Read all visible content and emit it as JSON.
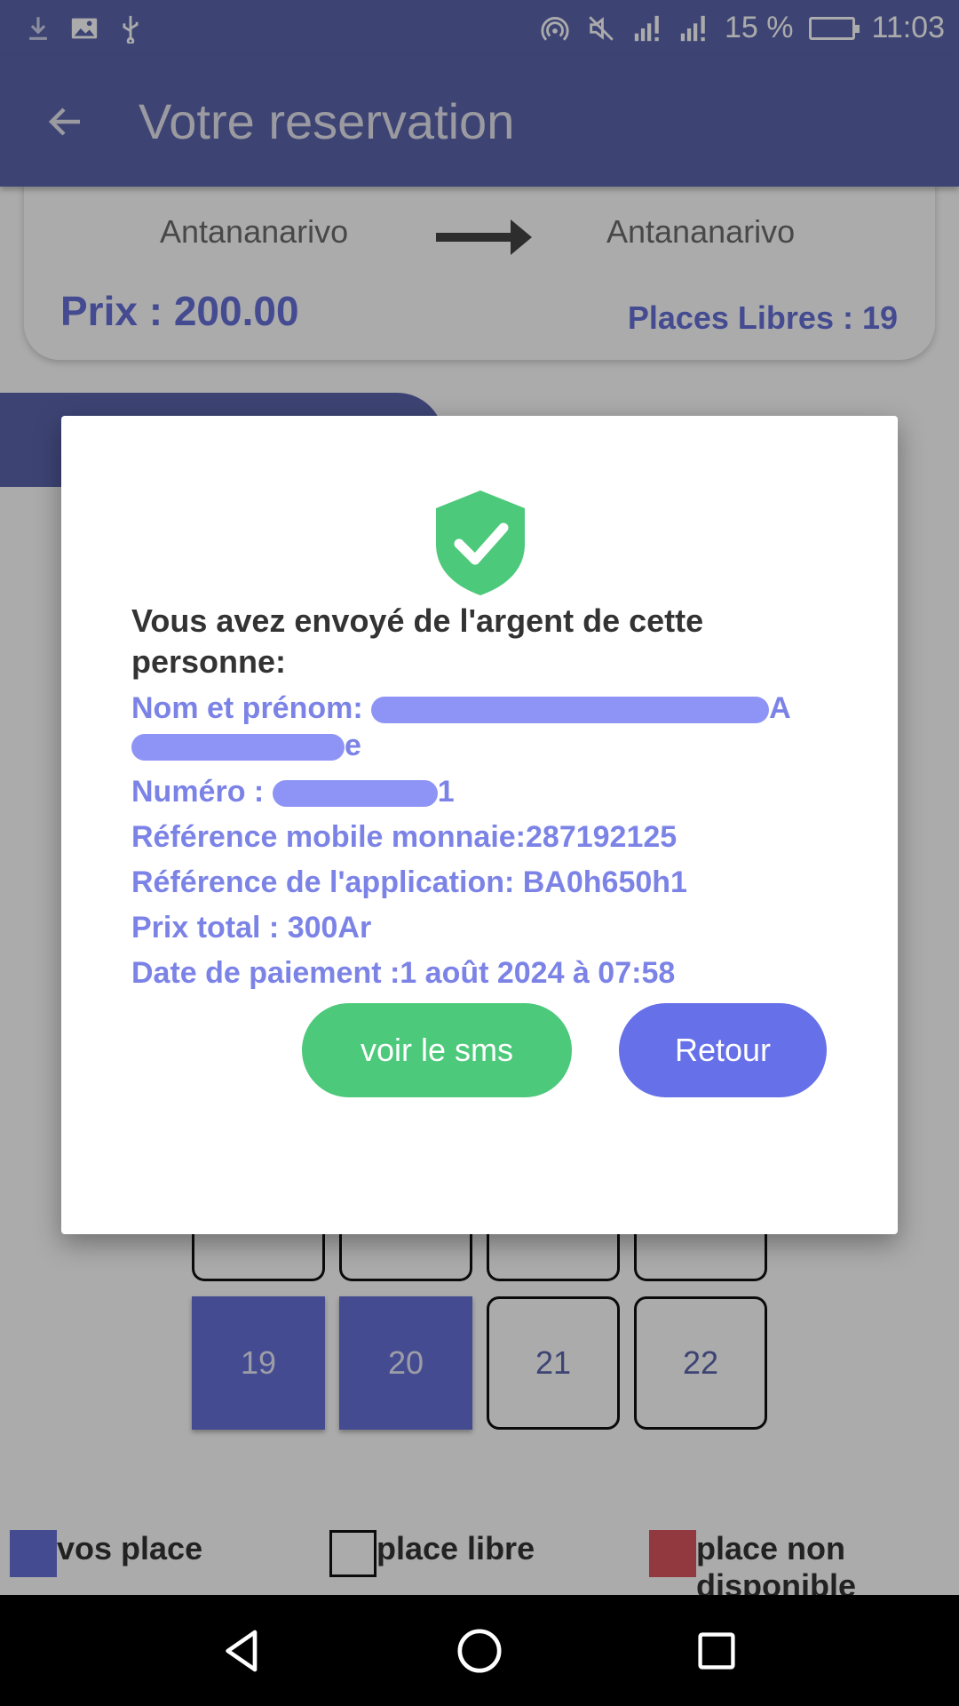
{
  "status_bar": {
    "battery_text": "15 %",
    "time": "11:03",
    "battery_level": 0.15,
    "icons_left": [
      "download-icon",
      "image-icon",
      "usb-icon"
    ],
    "icons_right": [
      "hotspot-icon",
      "mute-icon",
      "signal-icon",
      "signal-icon",
      "battery-icon"
    ]
  },
  "app_bar": {
    "title": "Votre reservation"
  },
  "route": {
    "from": "Antananarivo",
    "to": "Antananarivo",
    "price": "Prix : 200.00",
    "places": "Places Libres : 19"
  },
  "dialog": {
    "heading": "Vous avez envoyé de l'argent de cette personne:",
    "name_label": "Nom et prénom: ",
    "name_end_visible": "A",
    "name_line2_visible": "e",
    "number_label": "Numéro : ",
    "number_end_visible": "1",
    "ref_mobile": "Référence mobile monnaie:287192125",
    "ref_app": "Référence de l'application: BA0h650h1",
    "total": "Prix total : 300Ar",
    "date": "Date de paiement :1 août 2024 à 07:58",
    "btn_sms": "voir le sms",
    "btn_back": "Retour"
  },
  "seats": [
    {
      "label": "19",
      "status": "mine"
    },
    {
      "label": "20",
      "status": "mine"
    },
    {
      "label": "21",
      "status": "free"
    },
    {
      "label": "22",
      "status": "free"
    }
  ],
  "legend": [
    {
      "label": "vos place",
      "color": "#6670d8"
    },
    {
      "label": "place libre",
      "color": "#ffffff"
    },
    {
      "label": "place non disponible",
      "color": "#d9565f"
    }
  ],
  "colors": {
    "primary": "#5c66ad",
    "accent": "#6670e8",
    "success": "#4cc97a"
  }
}
